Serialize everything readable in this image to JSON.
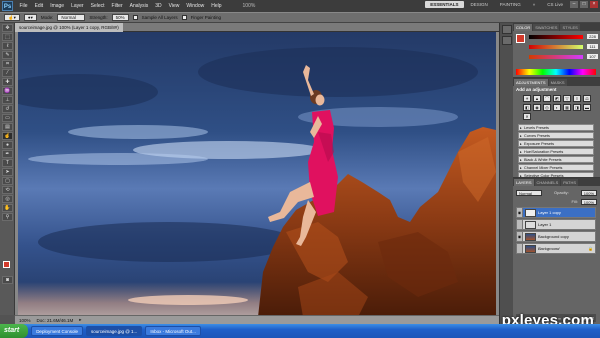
{
  "menubar": {
    "logo": "Ps",
    "items": [
      "File",
      "Edit",
      "Image",
      "Layer",
      "Select",
      "Filter",
      "Analysis",
      "3D",
      "View",
      "Window",
      "Help"
    ],
    "zoom": "100%",
    "workspaces": [
      "ESSENTIALS",
      "DESIGN",
      "PAINTING"
    ],
    "search_label": "CS Live"
  },
  "options": {
    "mode_label": "Mode:",
    "mode_value": "Normal",
    "strength_label": "Strength:",
    "strength_value": "50%",
    "sample_all_layers": "Sample All Layers",
    "finger_painting": "Finger Painting"
  },
  "document": {
    "tab_title": "sourceimage.jpg @ 100% (Layer 1 copy, RGB/8#)"
  },
  "status": {
    "zoom": "100%",
    "doc_size": "Doc: 21.6M/46.1M"
  },
  "panels": {
    "color_tabs": [
      "COLOR",
      "SWATCHES",
      "STYLES"
    ],
    "color_values": [
      "228",
      "111",
      "107"
    ],
    "adjustments_tabs": [
      "ADJUSTMENTS",
      "MASKS"
    ],
    "adjustments_title": "Add an adjustment",
    "presets": [
      "Levels Presets",
      "Curves Presets",
      "Exposure Presets",
      "Hue/Saturation Presets",
      "Black & White Presets",
      "Channel Mixer Presets",
      "Selective Color Presets"
    ],
    "layers_tabs": [
      "LAYERS",
      "CHANNELS",
      "PATHS"
    ],
    "blend_mode": "Normal",
    "opacity_label": "Opacity:",
    "opacity_value": "100%",
    "fill_label": "Fill:",
    "fill_value": "100%",
    "layers": [
      {
        "name": "Layer 1 copy"
      },
      {
        "name": "Layer 1"
      },
      {
        "name": "Background copy"
      },
      {
        "name": "Background"
      }
    ]
  },
  "taskbar": {
    "start": "start",
    "tasks": [
      "Deployment Console",
      "sourceimage.jpg @ 1...",
      "Inbox - Microsoft Out..."
    ]
  },
  "watermark": "pxleyes.com",
  "colors": {
    "foreground": "#d23b2c",
    "background": "#ffffff",
    "selected_layer": "#3b6fc4",
    "dress": "#e0115f"
  }
}
